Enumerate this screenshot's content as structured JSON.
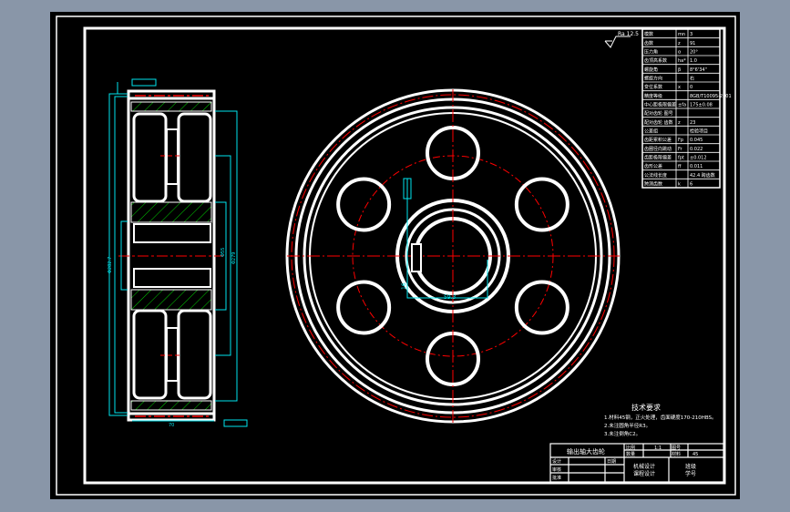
{
  "colors": {
    "background": "#8996a8",
    "model_space": "#000000",
    "geometry": "#ffffff",
    "centerline": "#ff0000",
    "dimension": "#00e5ee",
    "hatch": "#00d000"
  },
  "roughness_general": "Ra 12.5",
  "gear_table": [
    {
      "name": "模数",
      "symbol": "mn",
      "value": "3"
    },
    {
      "name": "齿数",
      "symbol": "z",
      "value": "91"
    },
    {
      "name": "压力角",
      "symbol": "α",
      "value": "20°"
    },
    {
      "name": "齿顶高系数",
      "symbol": "ha*",
      "value": "1.0"
    },
    {
      "name": "螺旋角",
      "symbol": "β",
      "value": "8°6'34\""
    },
    {
      "name": "螺旋方向",
      "symbol": "",
      "value": "右"
    },
    {
      "name": "变位系数",
      "symbol": "x",
      "value": "0"
    },
    {
      "name": "精度等级",
      "symbol": "",
      "value": "8GB/T10095-2001"
    },
    {
      "name": "中心距极限偏差",
      "symbol": "±fa",
      "value": "175±0.08"
    },
    {
      "name": "配对齿轮 图号",
      "symbol": "",
      "value": ""
    },
    {
      "name": "配对齿轮 齿数",
      "symbol": "z",
      "value": "23"
    },
    {
      "name": "公差组",
      "symbol": "",
      "value": "检验项目"
    },
    {
      "name": "齿距累积公差",
      "symbol": "Fp",
      "value": "0.045"
    },
    {
      "name": "齿圈径向跳动",
      "symbol": "Fr",
      "value": "0.022"
    },
    {
      "name": "齿距极限偏差",
      "symbol": "fpt",
      "value": "±0.012"
    },
    {
      "name": "齿形公差",
      "symbol": "ff",
      "value": "0.011"
    },
    {
      "name": "公法线长度",
      "symbol": "",
      "value": "42.4 跨齿数"
    },
    {
      "name": "跨测齿数",
      "symbol": "k",
      "value": "6"
    }
  ],
  "tech_requirements": {
    "title": "技术要求",
    "items": [
      "1.材料45钢，正火处理，齿面硬度170-210HBS。",
      "2.未注圆角半径R3。",
      "3.未注倒角C2。"
    ]
  },
  "title_block": {
    "part_name": "输出轴大齿轮",
    "scale_label": "比例",
    "scale_value": "1:1",
    "count_label": "数量",
    "count_value": "",
    "material_label": "材料",
    "material_value": "45",
    "sheet_label": "图号",
    "design": "设计",
    "check": "审核",
    "approve": "批准",
    "date": "日期",
    "course": "机械设计",
    "course2": "课程设计",
    "class": "班级",
    "student_no": "学号"
  },
  "dimensions": {
    "hole_dia": "Φ55",
    "keyway": "16",
    "keyway_depth": "59.3",
    "hub_width": "70",
    "rim": "Φ279",
    "tip_dia": "Φ282.7"
  }
}
